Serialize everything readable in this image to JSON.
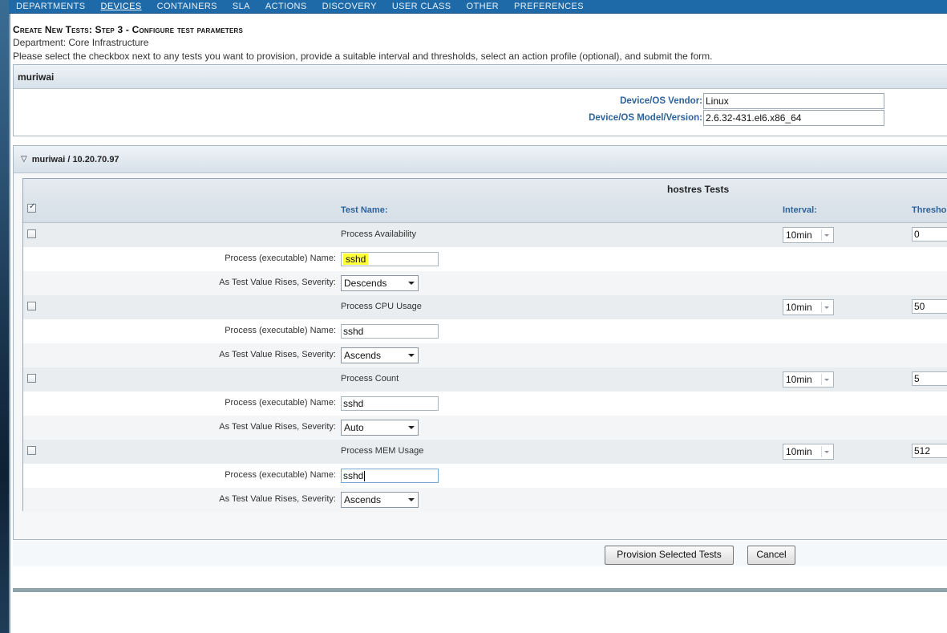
{
  "nav": {
    "items": [
      "DEPARTMENTS",
      "DEVICES",
      "CONTAINERS",
      "SLA",
      "ACTIONS",
      "DISCOVERY",
      "USER CLASS",
      "OTHER",
      "PREFERENCES"
    ],
    "active": "DEVICES"
  },
  "page": {
    "heading": "Create New Tests: Step 3 - Configure test parameters",
    "department": "Department: Core Infrastructure",
    "instructions": "Please select the checkbox next to any tests you want to provision, provide a suitable interval and thresholds, select an action profile (optional), and submit the form."
  },
  "device": {
    "name": "muriwai",
    "vendor_label": "Device/OS Vendor:",
    "vendor_value": "Linux",
    "model_label": "Device/OS Model/Version:",
    "model_value": "2.6.32-431.el6.x86_64"
  },
  "tests_panel": {
    "header": "muriwai / 10.20.70.97",
    "table_title": "hostres Tests",
    "col_test_name": "Test Name:",
    "col_interval": "Interval:",
    "col_threshold": "Thresho",
    "select_all_checked": true
  },
  "tests": [
    {
      "name": "Process Availability",
      "interval": "10min",
      "threshold": "0",
      "process_label": "Process (executable) Name:",
      "process_name": "sshd",
      "severity_label": "As Test Value Rises, Severity:",
      "severity": "Descends"
    },
    {
      "name": "Process CPU Usage",
      "interval": "10min",
      "threshold": "50",
      "process_label": "Process (executable) Name:",
      "process_name": "sshd",
      "severity_label": "As Test Value Rises, Severity:",
      "severity": "Ascends"
    },
    {
      "name": "Process Count",
      "interval": "10min",
      "threshold": "5",
      "process_label": "Process (executable) Name:",
      "process_name": "sshd",
      "severity_label": "As Test Value Rises, Severity:",
      "severity": "Auto"
    },
    {
      "name": "Process MEM Usage",
      "interval": "10min",
      "threshold": "512",
      "process_label": "Process (executable) Name:",
      "process_name": "sshd",
      "severity_label": "As Test Value Rises, Severity:",
      "severity": "Ascends"
    }
  ],
  "buttons": {
    "provision": "Provision Selected Tests",
    "cancel": "Cancel"
  },
  "colors": {
    "nav_bg": "#1e6aa8",
    "label_blue": "#2e6299",
    "highlight": "#ffff35"
  }
}
